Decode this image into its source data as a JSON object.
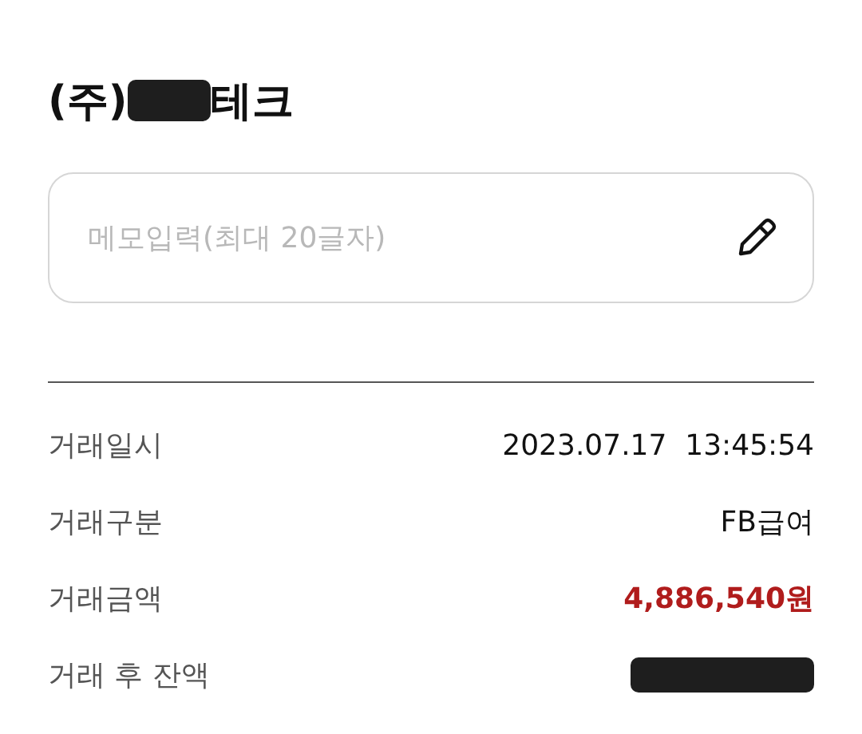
{
  "title": {
    "parts": [
      {
        "kind": "text",
        "text": "(주)"
      },
      {
        "kind": "redacted"
      },
      {
        "kind": "text",
        "text": "테크"
      }
    ]
  },
  "memo": {
    "placeholder": "메모입력(최대 20글자)"
  },
  "details": [
    {
      "label": "거래일시",
      "kind": "text",
      "value": "2023.07.17  13:45:54"
    },
    {
      "label": "거래구분",
      "kind": "text",
      "value": "FB급여"
    },
    {
      "label": "거래금액",
      "kind": "amount",
      "value": "4,886,540원"
    },
    {
      "label": "거래 후 잔액",
      "kind": "redacted"
    }
  ]
}
